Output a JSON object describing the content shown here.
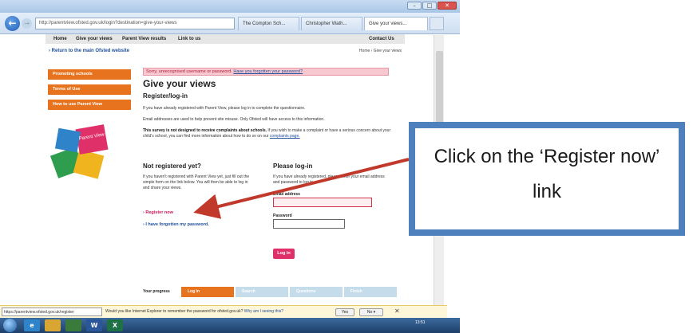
{
  "browser": {
    "address": "http://parentview.ofsted.gov.uk/login?destination=give-your-views",
    "tabs": [
      "The Compton Sch...",
      "Christopher Wath...",
      "Give your views..."
    ],
    "back_glyph": "←",
    "forward_glyph": "→",
    "win_min": "–",
    "win_max": "□",
    "win_close": "✕"
  },
  "site_nav": {
    "home": "Home",
    "give_views": "Give your views",
    "results": "Parent View results",
    "link_to_us": "Link to us",
    "contact": "Contact Us"
  },
  "return_link": "› Return to the main Ofsted website",
  "breadcrumb": "Home › Give your views",
  "sidebar": {
    "items": [
      "Promoting schools",
      "Terms of Use",
      "How to use Parent View"
    ],
    "puzzle_text": "Parent View"
  },
  "main": {
    "error_text": "Sorry, unrecognised username or password.",
    "error_link": "Have you forgotten your password?",
    "title": "Give your views",
    "subtitle": "Register/log-in",
    "para1": "If you have already registered with Parent View, please log in to complete the questionnaire.",
    "para2": "Email addresses are used to help prevent site misuse. Only Ofsted will have access to this information.",
    "para3_bold": "This survey is not designed to receive complaints about schools.",
    "para3_rest": " If you wish to make a complaint or have a serious concern about your child's school, you can find more information about how to do so on our",
    "para3_link": "complaints page.",
    "not_registered_title": "Not registered yet?",
    "not_registered_text": "If you haven't registered with Parent View yet, just fill out the simple form on the link below. You will then be able to log in and share your views.",
    "register_link": "› Register now",
    "forgot_link": "› I have forgotten my password.",
    "login_title": "Please log-in",
    "login_text": "If you have already registered, please enter your email address and password to log in.",
    "email_label": "Email address",
    "password_label": "Password",
    "login_button": "Log in",
    "progress_label": "Your progress",
    "progress_steps": [
      "Log in",
      "Search",
      "Questions",
      "Finish"
    ]
  },
  "notification": {
    "status_url": "https://parentview.ofsted.gov.uk/register",
    "text": "Would you like Internet Explorer to remember the password for ofsted.gov.uk?",
    "link": "Why am I seeing this?",
    "yes": "Yes",
    "no": "No ▾",
    "close": "✕"
  },
  "taskbar": {
    "clock": "13:51"
  },
  "callout": {
    "text": "Click on the ‘Register now’ link"
  },
  "colors": {
    "orange": "#e8731f",
    "pink": "#e0306a",
    "callout_border": "#4e80bd",
    "arrow": "#c0392b"
  }
}
